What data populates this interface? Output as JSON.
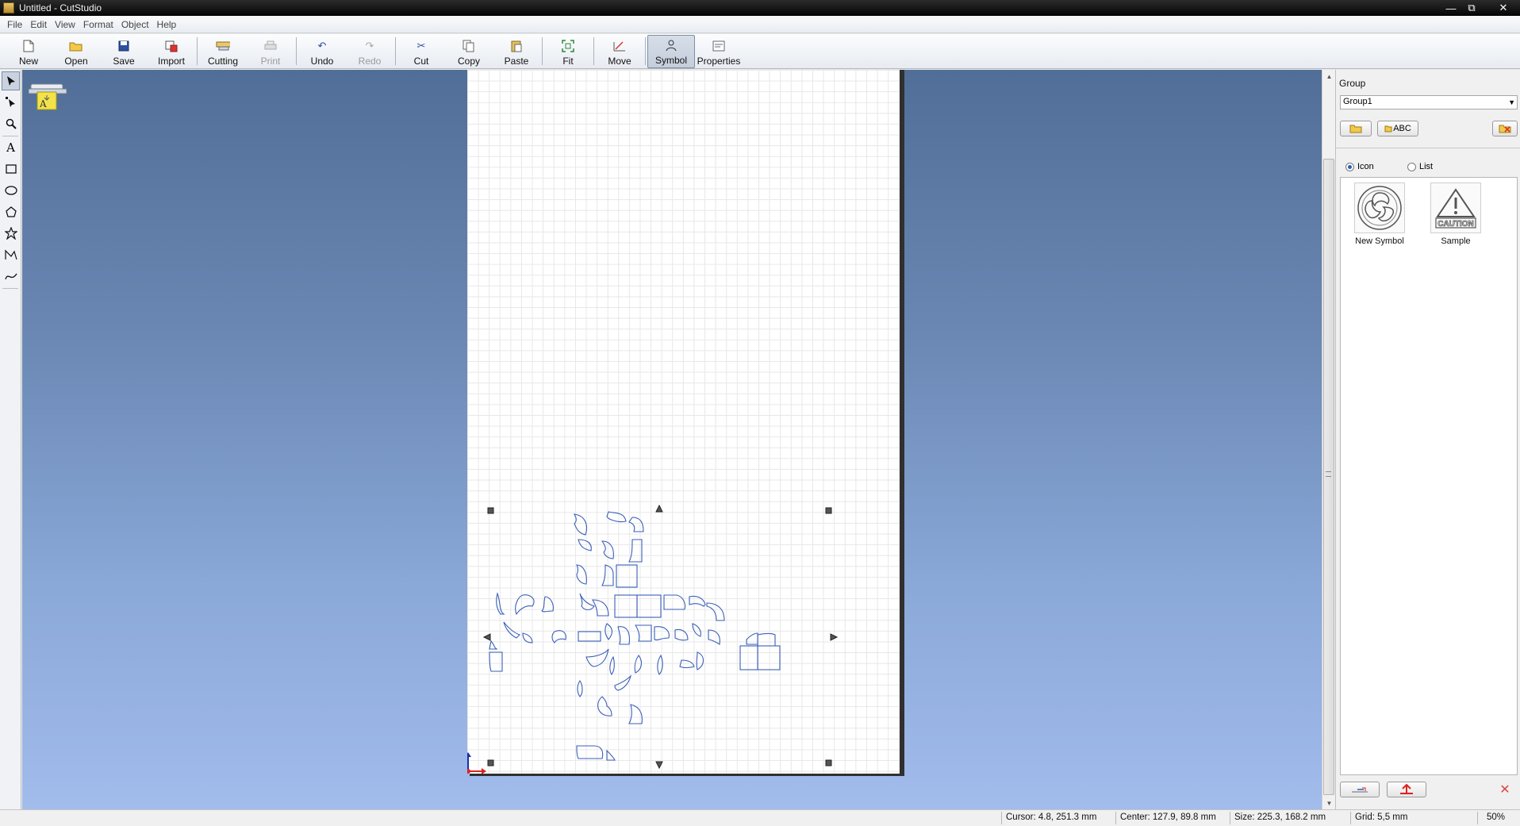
{
  "window": {
    "title": "Untitled - CutStudio"
  },
  "menu": [
    "File",
    "Edit",
    "View",
    "Format",
    "Object",
    "Help"
  ],
  "toolbar": [
    {
      "label": "New",
      "icon": "new-document-icon",
      "state": "enabled"
    },
    {
      "label": "Open",
      "icon": "open-folder-icon",
      "state": "enabled"
    },
    {
      "label": "Save",
      "icon": "save-disk-icon",
      "state": "enabled"
    },
    {
      "label": "Import",
      "icon": "import-icon",
      "state": "enabled"
    },
    {
      "label": "Cutting",
      "icon": "cutter-icon",
      "state": "enabled"
    },
    {
      "label": "Print",
      "icon": "printer-icon",
      "state": "disabled"
    },
    {
      "label": "Undo",
      "icon": "undo-icon",
      "state": "enabled"
    },
    {
      "label": "Redo",
      "icon": "redo-icon",
      "state": "disabled"
    },
    {
      "label": "Cut",
      "icon": "scissors-icon",
      "state": "enabled"
    },
    {
      "label": "Copy",
      "icon": "copy-icon",
      "state": "enabled"
    },
    {
      "label": "Paste",
      "icon": "paste-icon",
      "state": "enabled"
    },
    {
      "label": "Fit",
      "icon": "fit-icon",
      "state": "enabled"
    },
    {
      "label": "Move",
      "icon": "move-icon",
      "state": "enabled"
    },
    {
      "label": "Symbol",
      "icon": "symbol-icon",
      "state": "active"
    },
    {
      "label": "Properties",
      "icon": "properties-icon",
      "state": "enabled"
    }
  ],
  "left_tools": [
    {
      "name": "select-tool",
      "icon": "arrow-pointer-icon",
      "active": true
    },
    {
      "name": "edit-points-tool",
      "icon": "node-pointer-icon",
      "active": false
    },
    {
      "name": "zoom-tool",
      "icon": "magnifier-icon",
      "active": false
    },
    {
      "name": "text-tool",
      "icon": "text-a-icon",
      "active": false
    },
    {
      "name": "rectangle-tool",
      "icon": "rectangle-icon",
      "active": false
    },
    {
      "name": "ellipse-tool",
      "icon": "ellipse-icon",
      "active": false
    },
    {
      "name": "polygon-tool",
      "icon": "pentagon-icon",
      "active": false
    },
    {
      "name": "star-tool",
      "icon": "star-icon",
      "active": false
    },
    {
      "name": "polyline-tool",
      "icon": "polyline-icon",
      "active": false
    },
    {
      "name": "curve-tool",
      "icon": "curve-icon",
      "active": false
    }
  ],
  "symbol_panel": {
    "group_label": "Group",
    "group_value": "Group1",
    "text_button_label": "ABC",
    "view_options": [
      {
        "label": "Icon",
        "selected": true
      },
      {
        "label": "List",
        "selected": false
      }
    ],
    "symbols": [
      {
        "label": "New Symbol",
        "icon": "swirl-symbol-icon"
      },
      {
        "label": "Sample",
        "icon": "caution-sign-icon",
        "text": "CAUTION"
      }
    ]
  },
  "status": {
    "cursor": "Cursor: 4.8, 251.3 mm",
    "center": "Center: 127.9, 89.8 mm",
    "size": "Size: 225.3, 168.2 mm",
    "grid": "Grid: 5,5 mm",
    "zoom": "50%"
  },
  "colors": {
    "accent": "#3a5fb8",
    "cut_line": "#3a5fb8",
    "workspace_top": "#506e97",
    "workspace_bottom": "#a2bcec"
  }
}
